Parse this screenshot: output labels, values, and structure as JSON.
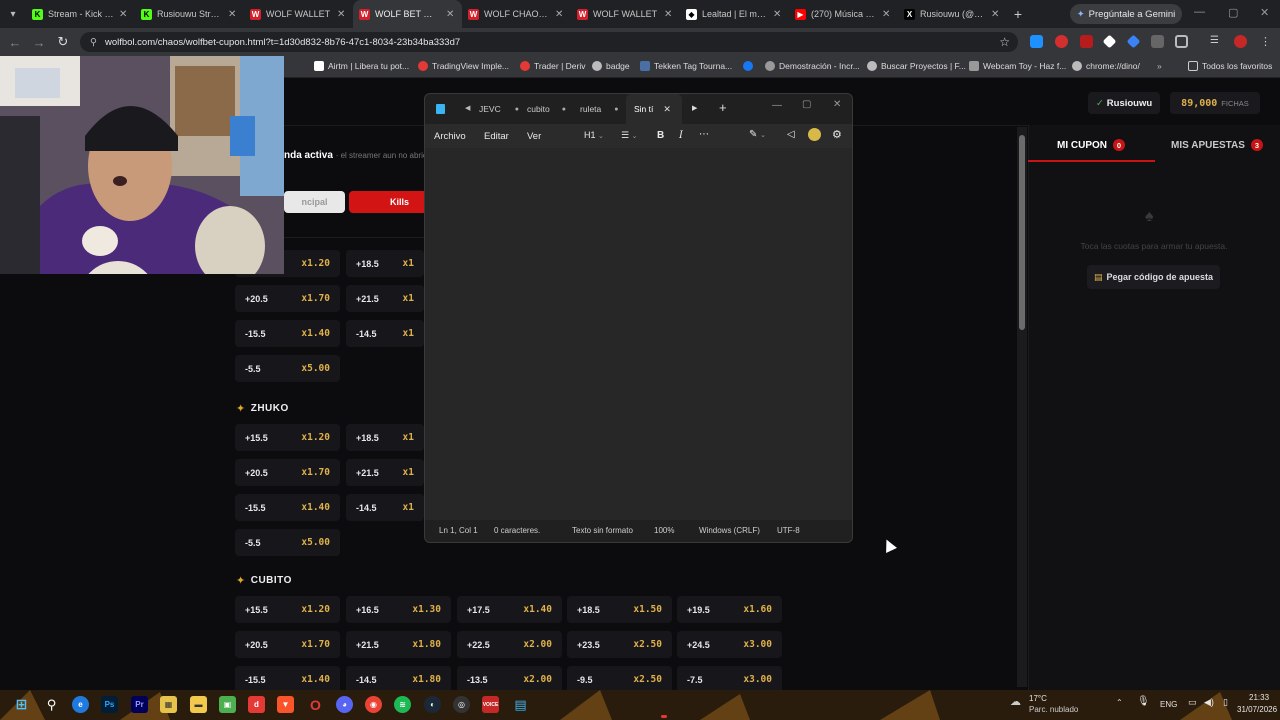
{
  "browser": {
    "tabs": [
      {
        "title": "Stream - Kick Da",
        "fav_color": "#53fc18",
        "fav_glyph": "K"
      },
      {
        "title": "Rusiouwu Stream",
        "fav_color": "#53fc18",
        "fav_glyph": "K"
      },
      {
        "title": "WOLF WALLET",
        "fav_color": "#d4202a",
        "fav_glyph": "W"
      },
      {
        "title": "WOLF BET — Cup",
        "fav_color": "#d4202a",
        "fav_glyph": "W",
        "active": true
      },
      {
        "title": "WOLF CHAOS —",
        "fav_color": "#d4202a",
        "fav_glyph": "W"
      },
      {
        "title": "WOLF WALLET",
        "fav_color": "#d4202a",
        "fav_glyph": "W"
      },
      {
        "title": "Lealtad | El mejor",
        "fav_color": "#ffffff",
        "fav_glyph": "◆"
      },
      {
        "title": "(270) Música de A",
        "fav_color": "#ff0000",
        "fav_glyph": "▶"
      },
      {
        "title": "Rusiouwu (@Rus",
        "fav_color": "#000000",
        "fav_glyph": "X"
      }
    ],
    "gemini_label": "Pregúntale a Gemini",
    "url": "wolfbol.com/chaos/wolfbet-cupon.html?t=1d30d832-8b76-47c1-8034-23b34ba333d7",
    "bookmarks": [
      "Airtm | Libera tu pot...",
      "TradingView Imple...",
      "Trader | Deriv",
      "badge",
      "Tekken Tag Tourna...",
      "Demostración - Incr...",
      "Buscar Proyectos | F...",
      "Webcam Toy - Haz f...",
      "chrome://dino/"
    ],
    "all_bookmarks_label": "Todos los favoritos"
  },
  "site": {
    "user_label": "Rusiouwu",
    "fichas_value": "89,000",
    "fichas_label": "FICHAS",
    "active_banner": "nda activa",
    "active_banner_sub": "· el streamer aun no abrio a",
    "mode_buttons": [
      "ncipal",
      "Kills"
    ],
    "right_tabs": [
      {
        "label": "MI CUPON",
        "count": "0"
      },
      {
        "label": "MIS APUESTAS",
        "count": "3"
      }
    ],
    "empty_text": "Toca las cuotas para armar tu apuesta.",
    "paste_button": "Pegar código de apuesta",
    "sections": [
      {
        "name": "",
        "rows": [
          [
            {
              "line": "",
              "mult": "x1.20"
            },
            {
              "line": "+18.5",
              "mult": "x1"
            }
          ],
          [
            {
              "line": "+20.5",
              "mult": "x1.70"
            },
            {
              "line": "+21.5",
              "mult": "x1"
            }
          ],
          [
            {
              "line": "-15.5",
              "mult": "x1.40"
            },
            {
              "line": "-14.5",
              "mult": "x1"
            }
          ],
          [
            {
              "line": "-5.5",
              "mult": "x5.00"
            }
          ]
        ]
      },
      {
        "name": "ZHUKO",
        "rows": [
          [
            {
              "line": "+15.5",
              "mult": "x1.20"
            },
            {
              "line": "+18.5",
              "mult": "x1"
            }
          ],
          [
            {
              "line": "+20.5",
              "mult": "x1.70"
            },
            {
              "line": "+21.5",
              "mult": "x1"
            }
          ],
          [
            {
              "line": "-15.5",
              "mult": "x1.40"
            },
            {
              "line": "-14.5",
              "mult": "x1"
            }
          ],
          [
            {
              "line": "-5.5",
              "mult": "x5.00"
            }
          ]
        ]
      },
      {
        "name": "CUBITO",
        "rows": [
          [
            {
              "line": "+15.5",
              "mult": "x1.20"
            },
            {
              "line": "+16.5",
              "mult": "x1.30"
            },
            {
              "line": "+17.5",
              "mult": "x1.40"
            },
            {
              "line": "+18.5",
              "mult": "x1.50"
            },
            {
              "line": "+19.5",
              "mult": "x1.60"
            }
          ],
          [
            {
              "line": "+20.5",
              "mult": "x1.70"
            },
            {
              "line": "+21.5",
              "mult": "x1.80"
            },
            {
              "line": "+22.5",
              "mult": "x2.00"
            },
            {
              "line": "+23.5",
              "mult": "x2.50"
            },
            {
              "line": "+24.5",
              "mult": "x3.00"
            }
          ],
          [
            {
              "line": "-15.5",
              "mult": "x1.40"
            },
            {
              "line": "-14.5",
              "mult": "x1.80"
            },
            {
              "line": "-13.5",
              "mult": "x2.00"
            },
            {
              "line": "-9.5",
              "mult": "x2.50"
            },
            {
              "line": "-7.5",
              "mult": "x3.00"
            }
          ]
        ]
      }
    ]
  },
  "notepad": {
    "tabs": [
      "JEVC",
      "cubito",
      "ruleta",
      "Sin tí"
    ],
    "menu": [
      "Archivo",
      "Editar",
      "Ver"
    ],
    "heading_label": "H1",
    "status": {
      "position": "Ln 1, Col 1",
      "chars": "0 caracteres.",
      "format": "Texto sin formato",
      "zoom": "100%",
      "eol": "Windows (CRLF)",
      "encoding": "UTF-8"
    }
  },
  "taskbar": {
    "weather_temp": "17°C",
    "weather_desc": "Parc. nublado",
    "lang": "ENG",
    "time": "21:33",
    "date": "31/07/2026"
  },
  "colors": {
    "accent_red": "#c81414",
    "odds_gold": "#e0b14a"
  }
}
